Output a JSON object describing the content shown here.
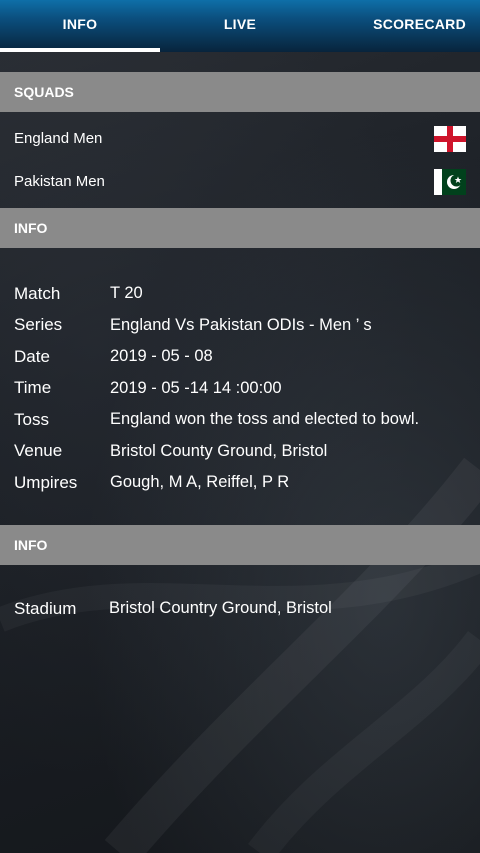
{
  "tabs": [
    {
      "label": "INFO",
      "active": true
    },
    {
      "label": "LIVE",
      "active": false
    },
    {
      "label": "SCORECARD",
      "active": false
    }
  ],
  "squads": {
    "header": "SQUADS",
    "teams": [
      {
        "name": "England Men",
        "flag_icon": "england-flag-icon"
      },
      {
        "name": "Pakistan Men",
        "flag_icon": "pakistan-flag-icon"
      }
    ]
  },
  "info": {
    "header": "INFO",
    "rows": [
      {
        "label": "Match",
        "value": "T 20"
      },
      {
        "label": "Series",
        "value": "England  Vs  Pakistan ODIs - Men ’ s"
      },
      {
        "label": "Date",
        "value": "2019 - 05 - 08"
      },
      {
        "label": "Time",
        "value": "2019 - 05 -14   14 :00:00"
      },
      {
        "label": "Toss",
        "value": "England won the toss and elected to bowl."
      },
      {
        "label": "Venue",
        "value": "Bristol County Ground, Bristol"
      },
      {
        "label": "Umpires",
        "value": "Gough, M A, Reiffel, P R"
      }
    ]
  },
  "venue_info": {
    "header": "INFO",
    "stadium_label": "Stadium",
    "stadium_value": "Bristol Country Ground, Bristol"
  },
  "colors": {
    "tab_gradient_top": "#0e6fa8",
    "section_header_bg": "#8a8a8a",
    "england_red": "#cf142b",
    "pakistan_green": "#01411c"
  }
}
